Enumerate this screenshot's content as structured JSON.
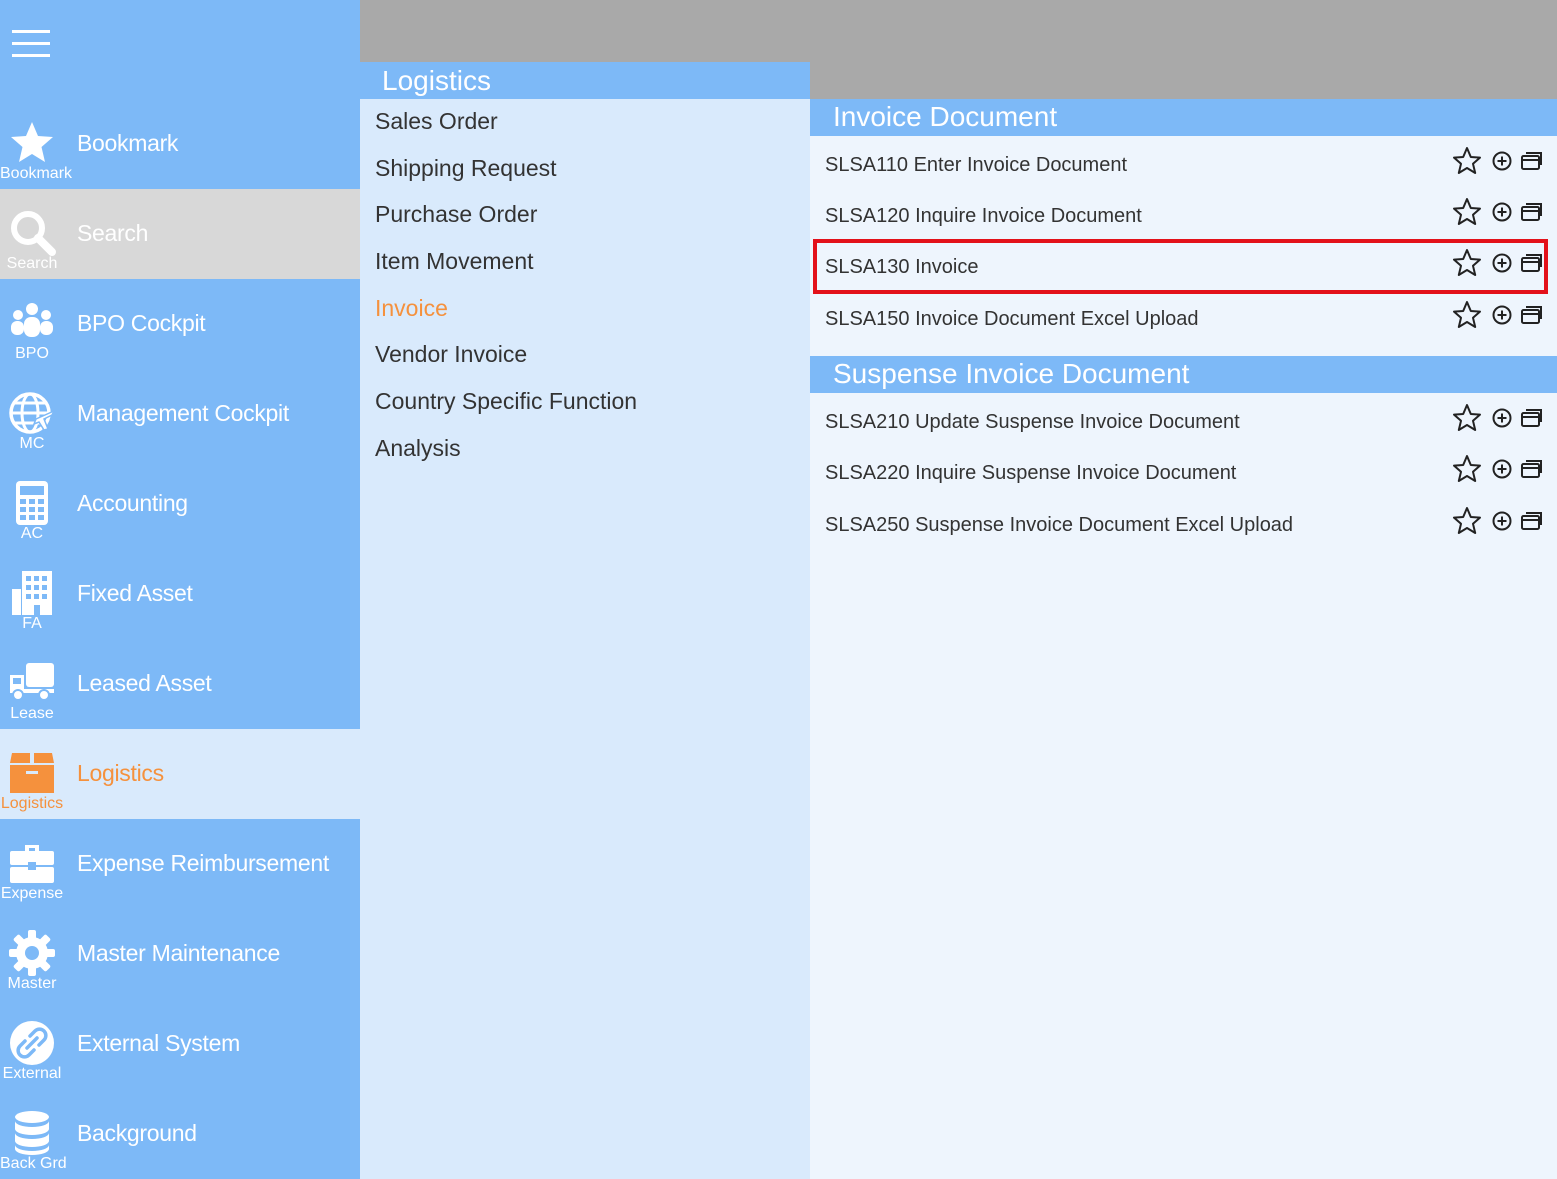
{
  "sidebar": {
    "menu_icon": "hamburger-icon",
    "items": [
      {
        "label": "Bookmark",
        "short": "Bookmark",
        "icon": "star-icon"
      },
      {
        "label": "Search",
        "short": "Search",
        "icon": "search-icon"
      },
      {
        "label": "BPO Cockpit",
        "short": "BPO",
        "icon": "people-group-icon"
      },
      {
        "label": "Management Cockpit",
        "short": "MC",
        "icon": "globe-plane-icon"
      },
      {
        "label": "Accounting",
        "short": "AC",
        "icon": "calculator-icon"
      },
      {
        "label": "Fixed Asset",
        "short": "FA",
        "icon": "building-icon"
      },
      {
        "label": "Leased Asset",
        "short": "Lease",
        "icon": "truck-icon"
      },
      {
        "label": "Logistics",
        "short": "Logistics",
        "icon": "box-icon"
      },
      {
        "label": "Expense Reimbursement",
        "short": "Expense",
        "icon": "briefcase-icon"
      },
      {
        "label": "Master Maintenance",
        "short": "Master",
        "icon": "gear-icon"
      },
      {
        "label": "External System",
        "short": "External",
        "icon": "link-icon"
      },
      {
        "label": "Background",
        "short": "Back Grd",
        "icon": "database-icon"
      }
    ],
    "active_color": "#f5913d"
  },
  "middle": {
    "title": "Logistics",
    "items": [
      {
        "label": "Sales Order"
      },
      {
        "label": "Shipping Request"
      },
      {
        "label": "Purchase Order"
      },
      {
        "label": "Item Movement"
      },
      {
        "label": "Invoice"
      },
      {
        "label": "Vendor Invoice"
      },
      {
        "label": "Country Specific Function"
      },
      {
        "label": "Analysis"
      }
    ]
  },
  "right": {
    "sections": [
      {
        "title": "Invoice Document",
        "rows": [
          {
            "label": "SLSA110 Enter Invoice Document"
          },
          {
            "label": "SLSA120 Inquire Invoice Document"
          },
          {
            "label": "SLSA130 Invoice"
          },
          {
            "label": "SLSA150 Invoice Document Excel Upload"
          }
        ]
      },
      {
        "title": "Suspense Invoice Document",
        "rows": [
          {
            "label": "SLSA210 Update Suspense Invoice Document"
          },
          {
            "label": "SLSA220 Inquire Suspense Invoice Document"
          },
          {
            "label": "SLSA250 Suspense Invoice Document Excel Upload"
          }
        ]
      }
    ],
    "row_icons": [
      "star-outline-icon",
      "plus-circle-icon",
      "new-window-icon"
    ],
    "highlight_color": "#e3111a"
  }
}
